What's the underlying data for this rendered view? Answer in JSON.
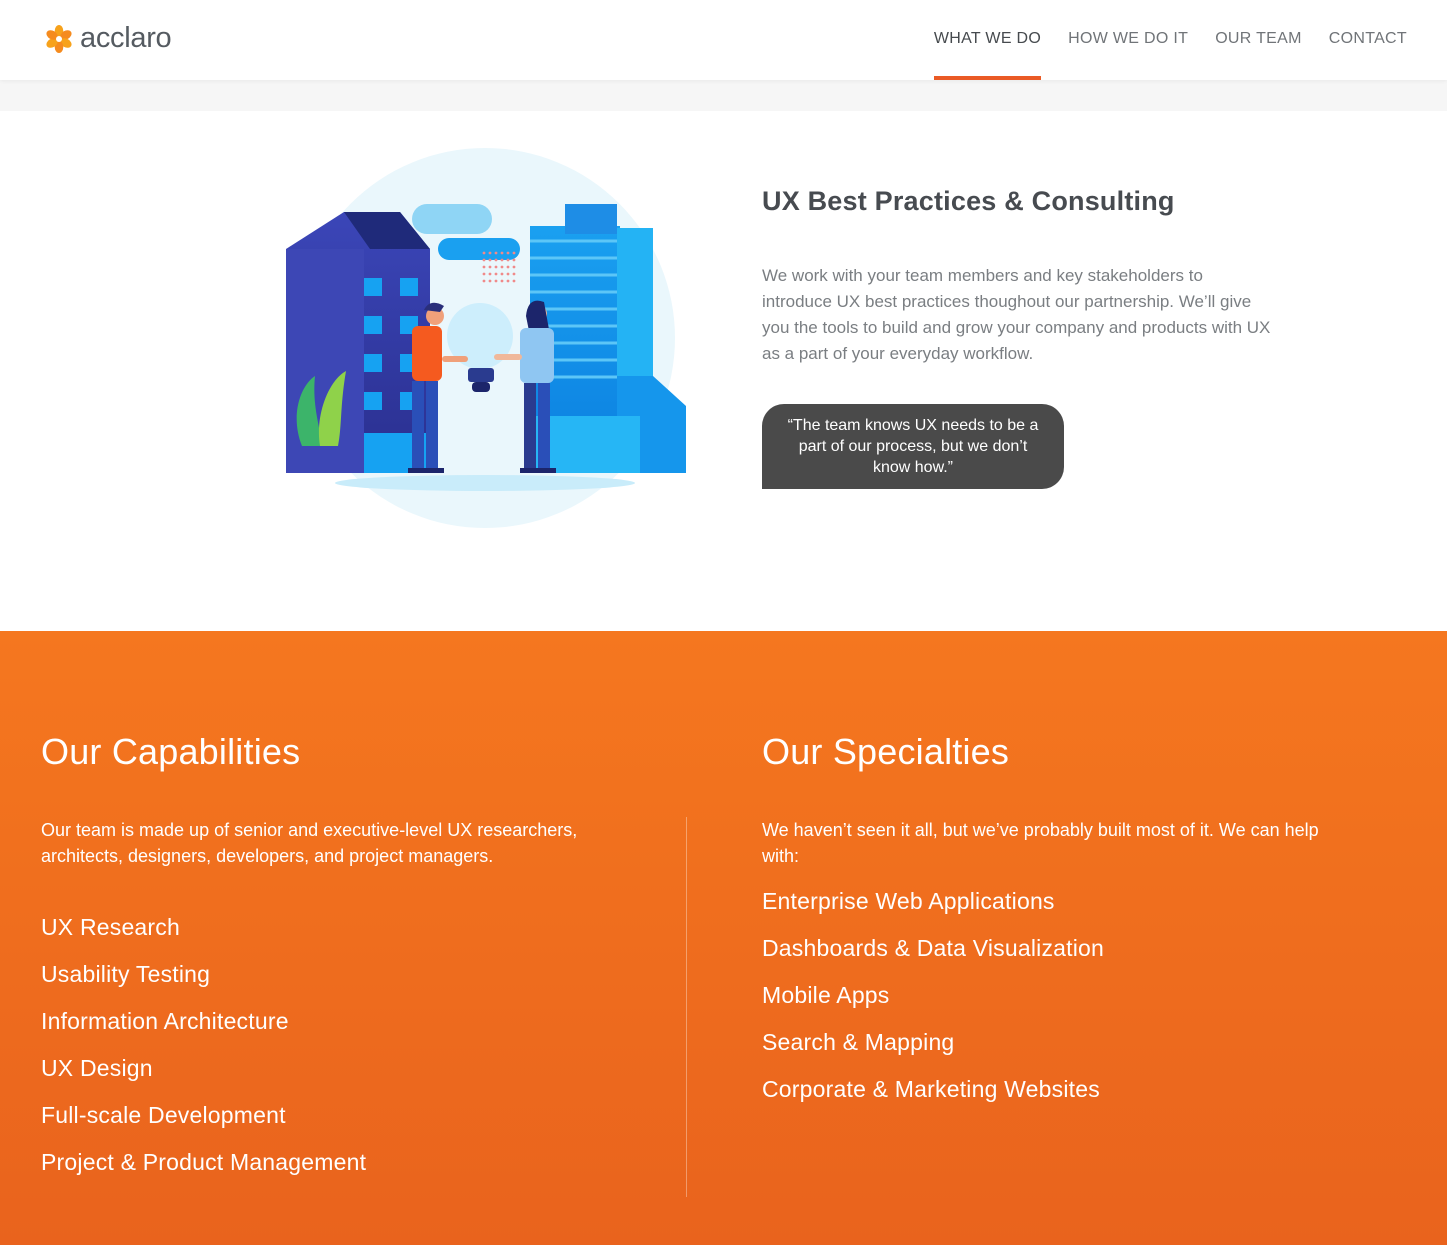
{
  "header": {
    "brand": "acclaro",
    "nav": [
      {
        "label": "WHAT WE DO",
        "active": true
      },
      {
        "label": "HOW WE DO IT",
        "active": false
      },
      {
        "label": "OUR TEAM",
        "active": false
      },
      {
        "label": "CONTACT",
        "active": false
      }
    ]
  },
  "hero": {
    "title": "UX Best Practices & Consulting",
    "body": "We work with your team members and key stakeholders to introduce UX best practices thoughout our partnership. We’ll give you the tools to build and grow your company and products with UX as a part of your everyday workflow.",
    "quote": "“The team knows UX needs to be a part of our process, but we don’t know how.”",
    "illustration_icon": "business-handshake-lightbulb-illustration"
  },
  "capabilities": {
    "title": "Our Capabilities",
    "intro": "Our team is made up of senior and executive-level UX researchers, architects, designers, developers, and project managers.",
    "items": [
      "UX Research",
      "Usability Testing",
      "Information Architecture",
      "UX Design",
      "Full-scale Development",
      "Project & Product Management"
    ]
  },
  "specialties": {
    "title": "Our Specialties",
    "intro": "We haven’t seen it all, but we’ve probably built most of it. We can help with:",
    "items": [
      "Enterprise Web Applications",
      "Dashboards & Data Visualization",
      "Mobile Apps",
      "Search & Mapping",
      "Corporate & Marketing Websites"
    ]
  },
  "colors": {
    "accent": "#ea5a25",
    "orange_top": "#f5771f",
    "orange_bottom": "#e9631d",
    "quote_bg": "#4a4a4a"
  }
}
